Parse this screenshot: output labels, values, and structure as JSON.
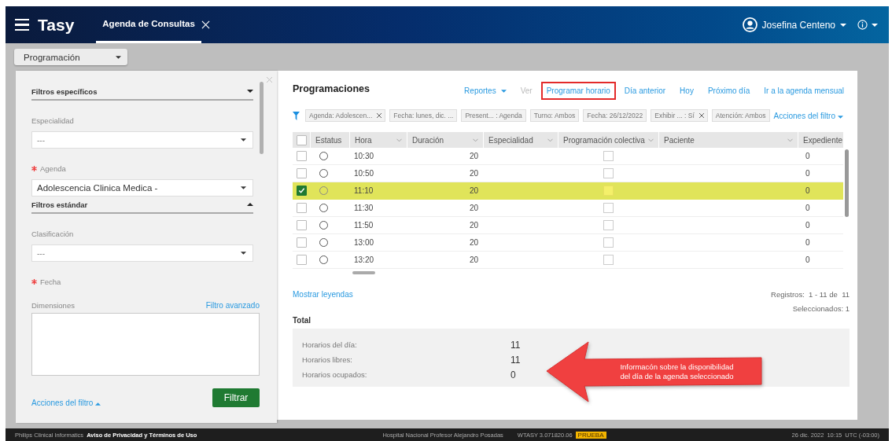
{
  "header": {
    "app_name": "Tasy",
    "tabs": [
      {
        "label": "Agenda de Consultas",
        "selected": true
      }
    ],
    "user": "Josefina Centeno"
  },
  "toolbar": {
    "dropdown": "Programación"
  },
  "filter_panel": {
    "sections": [
      {
        "title": "Filtros específicos",
        "expanded": false,
        "fields": [
          {
            "label": "Especialidad",
            "required": false,
            "placeholder": "---",
            "kind": "select"
          },
          {
            "label": "Agenda",
            "required": true,
            "value": "Adolescencia Clinica Medica -",
            "kind": "select"
          }
        ]
      },
      {
        "title": "Filtros estándar",
        "expanded": true,
        "fields": [
          {
            "label": "Clasificación",
            "required": false,
            "placeholder": "---",
            "kind": "select"
          },
          {
            "label": "Fecha",
            "required": true,
            "kind": "label"
          }
        ]
      }
    ],
    "dimensions_label": "Dimensiones",
    "advanced_link": "Filtro avanzado",
    "actions_link": "Acciones del filtro",
    "filter_button": "Filtrar"
  },
  "main": {
    "title": "Programaciones",
    "actions": [
      {
        "label": "Reportes",
        "kind": "menu",
        "disabled": false,
        "highlighted": false
      },
      {
        "label": "Ver",
        "kind": "link",
        "disabled": true,
        "highlighted": false
      },
      {
        "label": "Programar horario",
        "kind": "link",
        "disabled": false,
        "highlighted": true
      },
      {
        "label": "Día anterior",
        "kind": "link",
        "disabled": false,
        "highlighted": false
      },
      {
        "label": "Hoy",
        "kind": "link",
        "disabled": false,
        "highlighted": false
      },
      {
        "label": "Próximo día",
        "kind": "link",
        "disabled": false,
        "highlighted": false
      },
      {
        "label": "Ir a la agenda mensual",
        "kind": "link",
        "disabled": false,
        "highlighted": false
      }
    ],
    "filter_chips": [
      {
        "label": "Agenda: Adolescen...",
        "closable": true
      },
      {
        "label": "Fecha: lunes, dic. ...",
        "closable": false
      },
      {
        "label": "Present... : Agenda",
        "closable": false
      },
      {
        "label": "Turno: Ambos",
        "closable": false
      },
      {
        "label": "Fecha: 26/12/2022",
        "closable": false
      },
      {
        "label": "Exhibir ... : Sí",
        "closable": true
      },
      {
        "label": "Atención: Ambos",
        "closable": false
      }
    ],
    "filter_actions": "Acciones del filtro",
    "table": {
      "all_checked": false,
      "columns": [
        "Estatus",
        "Hora",
        "Duración",
        "Especialidad",
        "Programación colectiva",
        "Paciente",
        "Expediente"
      ],
      "rows": [
        {
          "checked": false,
          "selected": false,
          "hora": "10:30",
          "duracion": "20",
          "colectiva": false,
          "expediente": "0"
        },
        {
          "checked": false,
          "selected": false,
          "hora": "10:50",
          "duracion": "20",
          "colectiva": false,
          "expediente": "0"
        },
        {
          "checked": true,
          "selected": true,
          "hora": "11:10",
          "duracion": "20",
          "colectiva": false,
          "expediente": "0"
        },
        {
          "checked": false,
          "selected": false,
          "hora": "11:30",
          "duracion": "20",
          "colectiva": false,
          "expediente": "0"
        },
        {
          "checked": false,
          "selected": false,
          "hora": "11:50",
          "duracion": "20",
          "colectiva": false,
          "expediente": "0"
        },
        {
          "checked": false,
          "selected": false,
          "hora": "13:00",
          "duracion": "20",
          "colectiva": false,
          "expediente": "0"
        },
        {
          "checked": false,
          "selected": false,
          "hora": "13:20",
          "duracion": "20",
          "colectiva": false,
          "expediente": "0"
        }
      ]
    },
    "legend_link": "Mostrar leyendas",
    "records": "Registros:  1 - 11 de  11",
    "selected_count": "Seleccionados: 1",
    "totals": {
      "title": "Total",
      "items": [
        {
          "label": "Horarios del día:",
          "value": "11"
        },
        {
          "label": "Horarios libres:",
          "value": "11"
        },
        {
          "label": "Horarios ocupados:",
          "value": "0"
        }
      ]
    }
  },
  "callout": {
    "lines": [
      "Informacón sobre la disponibilidad",
      "del día de la agenda seleccionado"
    ]
  },
  "footer": {
    "company": "Philips Clinical Informatics",
    "privacy_link": "Aviso de Privacidad y Términos de Uso",
    "hospital": "Hospital Nacional Profesor Alejandro Posadas",
    "version": "WTASY 3.071820.06",
    "env_badge": "PRUEBA",
    "date": "26 dic. 2022",
    "time": "10:15",
    "timezone": "UTC (-03:00)"
  }
}
